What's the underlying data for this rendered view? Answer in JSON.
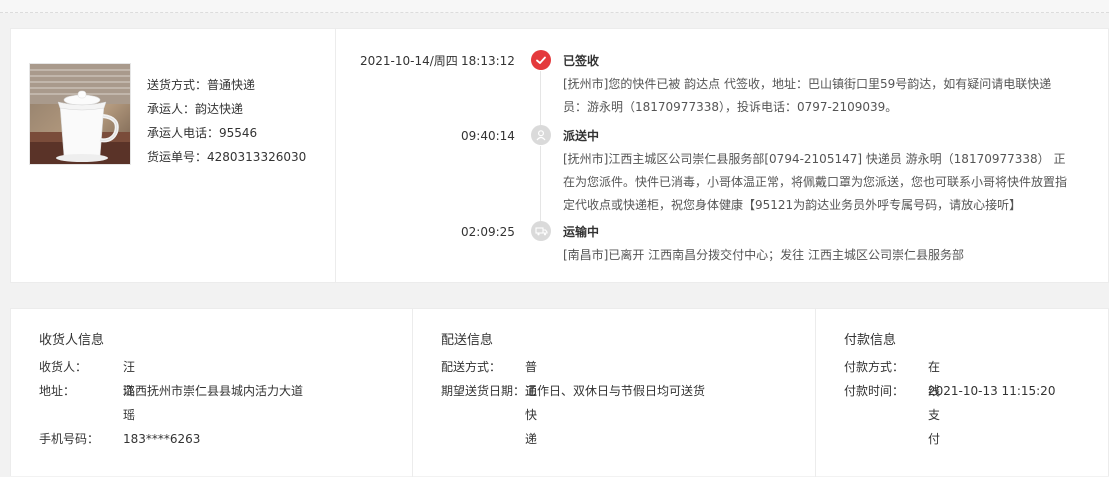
{
  "shipment": {
    "method": "送货方式：普通快递",
    "carrier": "承运人：韵达快递",
    "carrier_phone": "承运人电话：95546",
    "tracking_no": "货运单号：4280313326030"
  },
  "timeline": [
    {
      "date": "2021-10-14/周四",
      "time": "18:13:12",
      "status": "已签收",
      "icon": "check-icon",
      "desc": "[抚州市]您的快件已被 韵达点 代签收，地址：巴山镇街口里59号韵达，如有疑问请电联快递员：游永明（18170977338），投诉电话：0797-2109039。"
    },
    {
      "date": "",
      "time": "09:40:14",
      "status": "派送中",
      "icon": "courier-icon",
      "desc": "[抚州市]江西主城区公司崇仁县服务部[0794-2105147] 快递员 游永明（18170977338） 正在为您派件。快件已消毒，小哥体温正常，将佩戴口罩为您派送，您也可联系小哥将快件放置指定代收点或快递柜，祝您身体健康【95121为韵达业务员外呼专属号码，请放心接听】"
    },
    {
      "date": "",
      "time": "02:09:25",
      "status": "运输中",
      "icon": "truck-icon",
      "desc": "[南昌市]已离开 江西南昌分拨交付中心；发往 江西主城区公司崇仁县服务部"
    }
  ],
  "receiver": {
    "title": "收货人信息",
    "name_label": "收货人：",
    "name": "汪璐瑶",
    "address_label": "地址：",
    "address": "江西抚州市崇仁县县城内活力大道",
    "phone_label": "手机号码：",
    "phone": "183****6263"
  },
  "delivery": {
    "title": "配送信息",
    "method_label": "配送方式：",
    "method": "普通快递",
    "date_label": "期望送货日期：",
    "date": "工作日、双休日与节假日均可送货"
  },
  "payment": {
    "title": "付款信息",
    "method_label": "付款方式：",
    "method": "在线支付",
    "time_label": "付款时间：",
    "time": "2021-10-13 11:15:20"
  },
  "colors": {
    "accent": "#e4393c",
    "inactive_dot": "#dadada",
    "background": "#f2f2f2"
  }
}
